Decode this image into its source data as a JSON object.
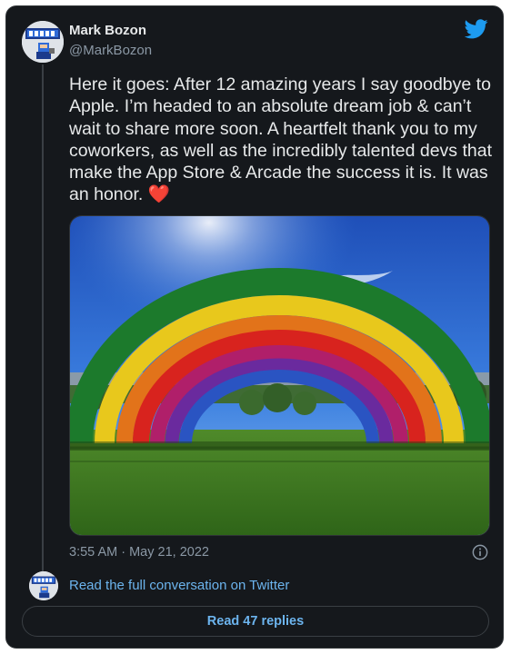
{
  "author": {
    "name": "Mark Bozon",
    "handle": "@MarkBozon",
    "avatar_icon": "pixel-art-avatar-icon"
  },
  "brand": {
    "icon": "twitter-bird-icon",
    "color": "#1d9bf0"
  },
  "tweet": {
    "text": "Here it goes: After 12 amazing years I say goodbye to Apple. I’m headed to an absolute dream job & can’t wait to share more soon. A heartfelt thank you to my coworkers, as well as the incredibly talented devs that make the App Store & Arcade the success it is. It was an honor. ",
    "emoji": "❤️",
    "timestamp": "3:55 AM · May 21, 2022",
    "info_icon": "info-icon"
  },
  "conversation": {
    "link_label": "Read the full conversation on Twitter"
  },
  "replies": {
    "label": "Read 47 replies"
  },
  "colors": {
    "background": "#15181c",
    "text": "#e7e9ea",
    "muted": "#8b98a5",
    "link": "#6cb4ee",
    "heart": "#f91880"
  }
}
